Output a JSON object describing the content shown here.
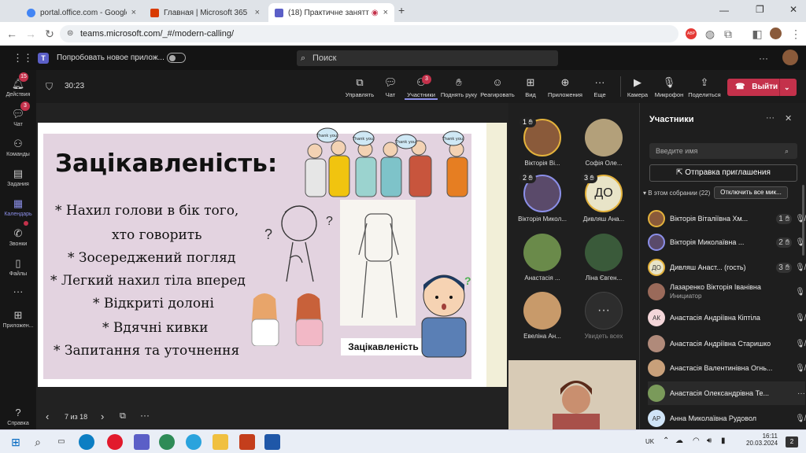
{
  "browser": {
    "tabs": [
      {
        "title": "portal.office.com - Google Sear",
        "close": "×",
        "color": "#4285f4"
      },
      {
        "title": "Главная | Microsoft 365",
        "close": "×",
        "color": "#d83b01"
      },
      {
        "title": "(18) Практичне заняття: На",
        "close": "×",
        "color": "#5b5fc7"
      }
    ],
    "new_tab": "+",
    "url": "teams.microsoft.com/_#/modern-calling/",
    "ext_badge": "ABP"
  },
  "teams": {
    "try_new": "Попробовать новое прилож...",
    "search_placeholder": "Поиск"
  },
  "rail": [
    {
      "label": "Действия",
      "icon": "bell-icon",
      "badge": "15"
    },
    {
      "label": "Чат",
      "icon": "chat-icon",
      "badge": "3"
    },
    {
      "label": "Команды",
      "icon": "teams-icon",
      "badge": ""
    },
    {
      "label": "Задания",
      "icon": "assignments-icon",
      "badge": ""
    },
    {
      "label": "Календарь",
      "icon": "calendar-icon",
      "badge": ""
    },
    {
      "label": "Звонки",
      "icon": "calls-icon",
      "badge": ""
    },
    {
      "label": "Файлы",
      "icon": "files-icon",
      "badge": ""
    },
    {
      "label": "",
      "icon": "more-icon",
      "badge": ""
    },
    {
      "label": "Приложен...",
      "icon": "apps-icon",
      "badge": ""
    },
    {
      "label": "Справка",
      "icon": "help-icon",
      "badge": ""
    }
  ],
  "meeting": {
    "timer": "30:23",
    "controls": [
      {
        "label": "Управлять",
        "icon": "manage-icon"
      },
      {
        "label": "Чат",
        "icon": "chat-icon"
      },
      {
        "label": "Участники",
        "icon": "people-icon",
        "badge": "3"
      },
      {
        "label": "Поднять руку",
        "icon": "hand-icon"
      },
      {
        "label": "Реагировать",
        "icon": "smile-icon"
      },
      {
        "label": "Вид",
        "icon": "view-icon"
      },
      {
        "label": "Приложения",
        "icon": "plus-icon"
      },
      {
        "label": "Еще",
        "icon": "ellipsis-icon"
      },
      {
        "label": "Камера",
        "icon": "camera-icon"
      },
      {
        "label": "Микрофон",
        "icon": "mic-icon"
      },
      {
        "label": "Поделиться",
        "icon": "share-icon"
      }
    ],
    "leave": "Выйти"
  },
  "slide": {
    "title": "Зацікавленість:",
    "bullets": [
      "* Нахил голови в бік того,",
      "хто говорить",
      "* Зосереджений погляд",
      "* Легкий нахил тіла вперед",
      "* Відкриті долоні",
      "* Вдячні кивки",
      "* Запитання та уточнення"
    ],
    "image_caption": "Зацікавленість",
    "bubbles": [
      "Thank you!",
      "Thank you!",
      "Thank you!",
      "Thank you!"
    ],
    "page": "7 из 18"
  },
  "grid": [
    {
      "name": "Вікторія Ві...",
      "hand": "1",
      "avatar": "",
      "color": "#8a5a3a"
    },
    {
      "name": "Софія Оле...",
      "hand": "",
      "avatar": "",
      "color": "#b3a07a"
    },
    {
      "name": "Вікторія Микол...",
      "hand": "2",
      "avatar": "",
      "color": "#5a4a6a"
    },
    {
      "name": "Дивляш Ана...",
      "hand": "3",
      "avatar": "ДО",
      "color": "#e8e4c8"
    },
    {
      "name": "Анастасія ...",
      "hand": "",
      "avatar": "",
      "color": "#6a8a4a"
    },
    {
      "name": "Ліна Євген...",
      "hand": "",
      "avatar": "",
      "color": "#3a5a3a"
    },
    {
      "name": "Евеліна Ан...",
      "hand": "",
      "avatar": "",
      "color": "#c89a6a"
    },
    {
      "name": "Увидеть всех",
      "hand": "",
      "avatar": "···",
      "color": "#2d2d2d"
    }
  ],
  "panel": {
    "title": "Участники",
    "name_placeholder": "Введите имя",
    "invite": "Отправка приглашения",
    "section": "В этом собрании (22)",
    "mute_all": "Отключить все мик...",
    "people": [
      {
        "name": "Вікторія Віталіївна Хм...",
        "sub": "",
        "hand": "1",
        "avatar": "",
        "bg": "#8a5a3a",
        "mic": "muted"
      },
      {
        "name": "Вікторія Миколаївна ...",
        "sub": "",
        "hand": "2",
        "avatar": "",
        "bg": "#5a4a6a",
        "mic": "on"
      },
      {
        "name": "Дивляш Анаст... (гость)",
        "sub": "",
        "hand": "3",
        "avatar": "ДО",
        "bg": "#e8e4c8",
        "mic": "muted"
      },
      {
        "name": "Лазаренко Вікторія Іванівна",
        "sub": "Инициатор",
        "hand": "",
        "avatar": "",
        "bg": "#9a6a5a",
        "mic": "on"
      },
      {
        "name": "Анастасія Андріївна Кіптіла",
        "sub": "",
        "hand": "",
        "avatar": "АК",
        "bg": "#f4d6d9",
        "mic": "muted"
      },
      {
        "name": "Анастасія Андріївна Старишко",
        "sub": "",
        "hand": "",
        "avatar": "",
        "bg": "#b08a7a",
        "mic": "muted"
      },
      {
        "name": "Анастасія Валентинівна Огнь...",
        "sub": "",
        "hand": "",
        "avatar": "",
        "bg": "#c8a07a",
        "mic": "muted"
      },
      {
        "name": "Анастасія Олександрівна Те...",
        "sub": "",
        "hand": "",
        "avatar": "",
        "bg": "#7a9a5a",
        "mic": "more"
      },
      {
        "name": "Анна Миколаївна Рудовол",
        "sub": "",
        "hand": "",
        "avatar": "АР",
        "bg": "#d0e4f7",
        "mic": "muted"
      }
    ]
  },
  "taskbar": {
    "lang": "UK",
    "time": "16:11",
    "date": "20.03.2024",
    "notif": "2"
  }
}
